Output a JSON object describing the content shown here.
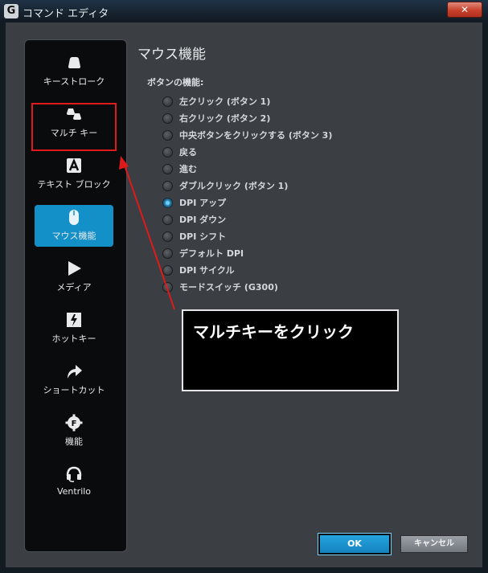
{
  "window": {
    "title": "コマンド エディタ",
    "logo": "G",
    "close_label": "✕"
  },
  "sidebar": {
    "items": [
      {
        "label": "キーストローク",
        "icon": "keystroke-icon"
      },
      {
        "label": "マルチ キー",
        "icon": "multikey-icon"
      },
      {
        "label": "テキスト ブロック",
        "icon": "text-block-icon"
      },
      {
        "label": "マウス機能",
        "icon": "mouse-icon",
        "active": true
      },
      {
        "label": "メディア",
        "icon": "media-play-icon"
      },
      {
        "label": "ホットキー",
        "icon": "hotkey-icon"
      },
      {
        "label": "ショートカット",
        "icon": "shortcut-icon"
      },
      {
        "label": "機能",
        "icon": "function-icon"
      },
      {
        "label": "Ventrilo",
        "icon": "headset-icon"
      }
    ]
  },
  "main": {
    "title": "マウス機能",
    "section_label": "ボタンの機能:",
    "options": [
      "左クリック (ボタン 1)",
      "右クリック (ボタン 2)",
      "中央ボタンをクリックする (ボタン 3)",
      "戻る",
      "進む",
      "ダブルクリック (ボタン 1)",
      "DPI アップ",
      "DPI ダウン",
      "DPI シフト",
      "デフォルト DPI",
      "DPI サイクル",
      "モードスイッチ (G300)"
    ],
    "selected_option": "DPI アップ"
  },
  "annotation": {
    "text": "マルチキーをクリック"
  },
  "buttons": {
    "ok": "OK",
    "cancel": "キャンセル"
  },
  "colors": {
    "accent": "#1490c9",
    "highlight": "#e01a1a"
  }
}
